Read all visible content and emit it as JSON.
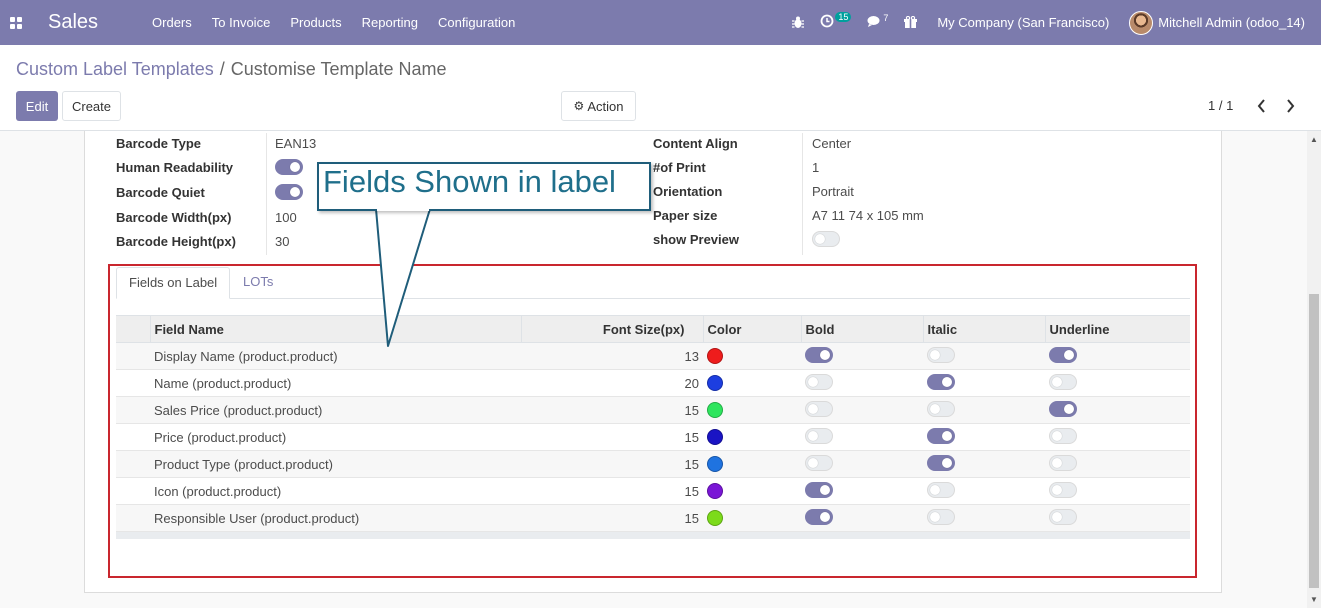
{
  "navbar": {
    "brand": "Sales",
    "menu": [
      "Orders",
      "To Invoice",
      "Products",
      "Reporting",
      "Configuration"
    ],
    "activity_count": "15",
    "messages_count": "7",
    "company": "My Company (San Francisco)",
    "user": "Mitchell Admin (odoo_14)",
    "icons": [
      "apps-icon",
      "bug-icon",
      "clock-icon",
      "chat-icon",
      "gift-icon"
    ]
  },
  "control_panel": {
    "breadcrumb_parent": "Custom Label Templates",
    "breadcrumb_separator": "/",
    "breadcrumb_current": "Customise Template Name",
    "edit_label": "Edit",
    "create_label": "Create",
    "action_label": "Action",
    "pager": "1 / 1"
  },
  "form": {
    "left": [
      {
        "label": "Barcode Type",
        "value": "EAN13"
      },
      {
        "label": "Human Readability",
        "toggle": true
      },
      {
        "label": "Barcode Quiet",
        "toggle": true
      },
      {
        "label": "Barcode Width(px)",
        "value": "100"
      },
      {
        "label": "Barcode Height(px)",
        "value": "30"
      }
    ],
    "right": [
      {
        "label": "Content Align",
        "value": "Center"
      },
      {
        "label": "#of Print",
        "value": "1"
      },
      {
        "label": "Orientation",
        "value": "Portrait"
      },
      {
        "label": "Paper size",
        "value": "A7 11 74 x 105 mm"
      },
      {
        "label": "show Preview",
        "toggle": false
      }
    ]
  },
  "notebook": {
    "tabs": [
      "Fields on Label",
      "LOTs"
    ],
    "active_tab": "Fields on Label",
    "columns": [
      "Field Name",
      "Font Size(px)",
      "Color",
      "Bold",
      "Italic",
      "Underline"
    ],
    "rows": [
      {
        "field": "Display Name (product.product)",
        "size": "13",
        "color": "#ee1c1c",
        "bold": true,
        "italic": false,
        "underline": true
      },
      {
        "field": "Name (product.product)",
        "size": "20",
        "color": "#1d3ee0",
        "bold": false,
        "italic": true,
        "underline": false
      },
      {
        "field": "Sales Price (product.product)",
        "size": "15",
        "color": "#2ee55e",
        "bold": false,
        "italic": false,
        "underline": true
      },
      {
        "field": "Price (product.product)",
        "size": "15",
        "color": "#1a14c4",
        "bold": false,
        "italic": true,
        "underline": false
      },
      {
        "field": "Product Type (product.product)",
        "size": "15",
        "color": "#1f73e0",
        "bold": false,
        "italic": true,
        "underline": false
      },
      {
        "field": "Icon (product.product)",
        "size": "15",
        "color": "#7a16d6",
        "bold": true,
        "italic": false,
        "underline": false
      },
      {
        "field": "Responsible User (product.product)",
        "size": "15",
        "color": "#7cdb1a",
        "bold": true,
        "italic": false,
        "underline": false
      }
    ]
  },
  "callout": {
    "text": "Fields Shown in label"
  },
  "colors": {
    "accent": "#7c7bad",
    "annotation_border": "#c9262e",
    "callout_text": "#1f6f8b"
  }
}
